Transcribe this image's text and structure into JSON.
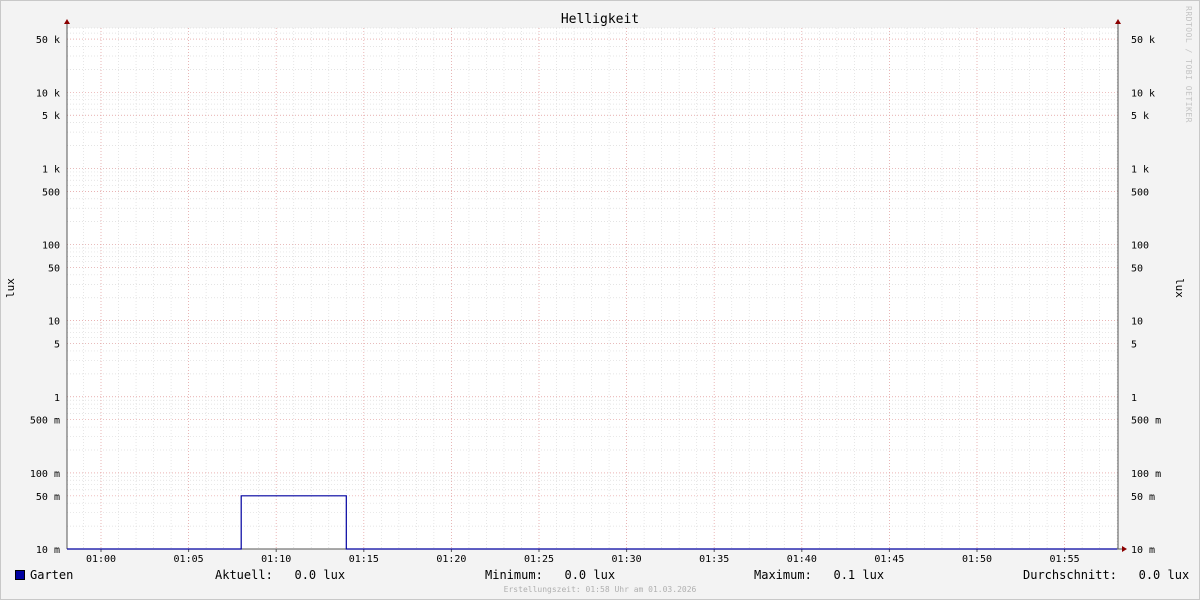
{
  "chart_data": {
    "type": "line",
    "title": "Helligkeit",
    "ylabel": "lux",
    "ylabel_right": "lux",
    "yscale": "log",
    "ylim": [
      0.01,
      70000
    ],
    "grid": true,
    "x_ticks": [
      "01:00",
      "01:05",
      "01:10",
      "01:15",
      "01:20",
      "01:25",
      "01:30",
      "01:35",
      "01:40",
      "01:45",
      "01:50",
      "01:55"
    ],
    "y_ticks": [
      {
        "value": 50000,
        "label": "50 k"
      },
      {
        "value": 10000,
        "label": "10 k"
      },
      {
        "value": 5000,
        "label": "5 k"
      },
      {
        "value": 1000,
        "label": "1 k"
      },
      {
        "value": 500,
        "label": "500"
      },
      {
        "value": 100,
        "label": "100"
      },
      {
        "value": 50,
        "label": "50"
      },
      {
        "value": 10,
        "label": "10"
      },
      {
        "value": 5,
        "label": "5"
      },
      {
        "value": 1,
        "label": "1"
      },
      {
        "value": 0.5,
        "label": "500 m"
      },
      {
        "value": 0.1,
        "label": "100 m"
      },
      {
        "value": 0.05,
        "label": "50 m"
      },
      {
        "value": 0.01,
        "label": "10 m"
      }
    ],
    "series": [
      {
        "name": "Garten",
        "color": "#0000a0",
        "x": [
          "00:58",
          "01:08",
          "01:08",
          "01:14",
          "01:14",
          "01:58"
        ],
        "y": [
          0.01,
          0.01,
          0.05,
          0.05,
          0.01,
          0.01
        ]
      }
    ]
  },
  "legend": {
    "series_name": "Garten",
    "current": "Aktuell:   0.0 lux",
    "minimum": "Minimum:   0.0 lux",
    "maximum": "Maximum:   0.1 lux",
    "average": "Durchschnitt:   0.0 lux"
  },
  "footer": "Erstellungszeit: 01:58 Uhr am 01.03.2026",
  "watermark": "RRDTOOL / TOBI OETIKER"
}
